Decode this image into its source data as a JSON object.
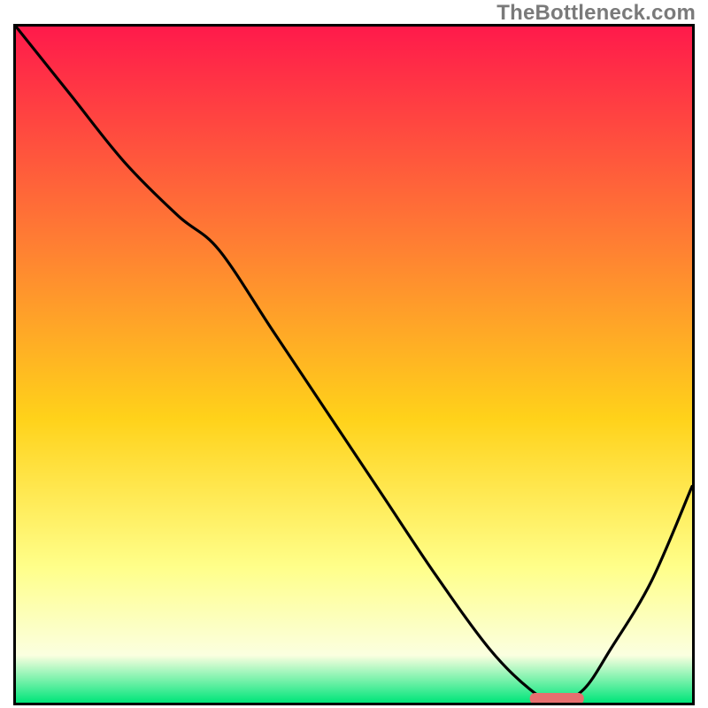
{
  "watermark": "TheBottleneck.com",
  "chart_data": {
    "type": "line",
    "title": "",
    "xlabel": "",
    "ylabel": "",
    "xlim": [
      0,
      100
    ],
    "ylim": [
      0,
      100
    ],
    "grid": false,
    "gradient": {
      "top": "#ff1a4b",
      "mid_upper": "#ff7e33",
      "mid": "#ffd21a",
      "mid_lower": "#ffff8a",
      "whitish": "#fbffe0",
      "bottom": "#00e57a"
    },
    "curve": {
      "description": "Black curve descending from top-left to a minimum near x≈80, then rising toward the right edge",
      "x": [
        0,
        8,
        16,
        24,
        30,
        38,
        46,
        54,
        62,
        70,
        76,
        80,
        84,
        88,
        94,
        100
      ],
      "y": [
        100,
        90,
        80,
        72,
        67,
        55,
        43,
        31,
        19,
        8,
        2,
        0,
        2,
        8,
        18,
        32
      ]
    },
    "marker": {
      "description": "Short rounded pink segment at the curve minimum, resting on the x-axis",
      "x_center": 80,
      "y": 0,
      "width_frac_of_x": 8,
      "color": "#e76f6f"
    }
  }
}
